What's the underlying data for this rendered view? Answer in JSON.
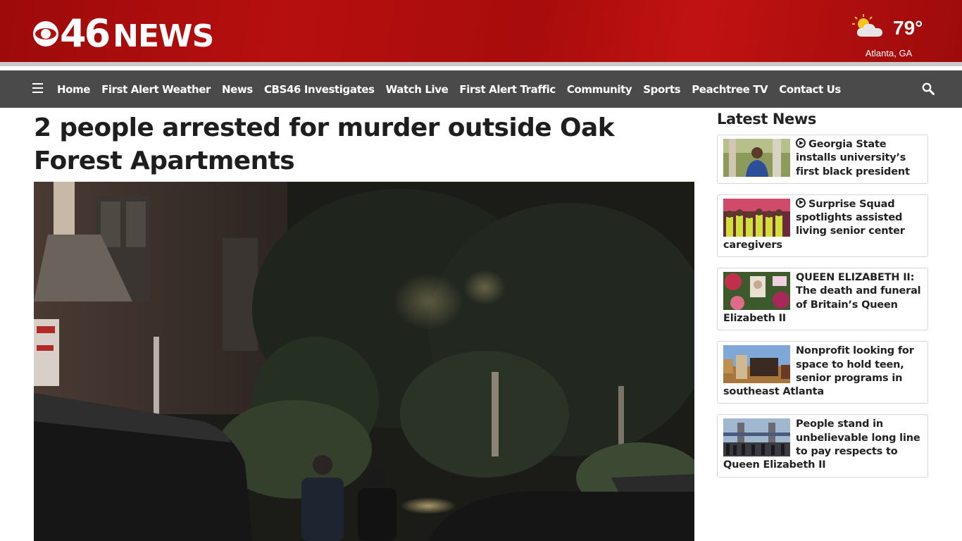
{
  "header": {
    "logo_number": "46",
    "logo_word": "NEWS",
    "weather": {
      "temperature": "79°",
      "city": "Atlanta, GA",
      "icon": "partly-sunny-icon"
    }
  },
  "nav": {
    "items": [
      "Home",
      "First Alert Weather",
      "News",
      "CBS46 Investigates",
      "Watch Live",
      "First Alert Traffic",
      "Community",
      "Sports",
      "Peachtree TV",
      "Contact Us"
    ],
    "menu_icon": "hamburger-menu-icon",
    "search_icon": "search-icon"
  },
  "article": {
    "headline": "2 people arrested for murder outside Oak Forest Apartments"
  },
  "sidebar": {
    "title": "Latest News",
    "stories": [
      {
        "title": "Georgia State installs university’s first black president",
        "video": true
      },
      {
        "title": "Surprise Squad spotlights assisted living senior center caregivers",
        "video": true
      },
      {
        "title": "QUEEN ELIZABETH II: The death and funeral of Britain’s Queen Elizabeth II",
        "video": false
      },
      {
        "title": "Nonprofit looking for space to hold teen, senior programs in southeast Atlanta",
        "video": false
      },
      {
        "title": "People stand in unbelievable long line to pay respects to Queen Elizabeth II",
        "video": false
      }
    ]
  },
  "colors": {
    "brand_red": "#b20e0e",
    "nav_gray": "#4a4a4a"
  }
}
